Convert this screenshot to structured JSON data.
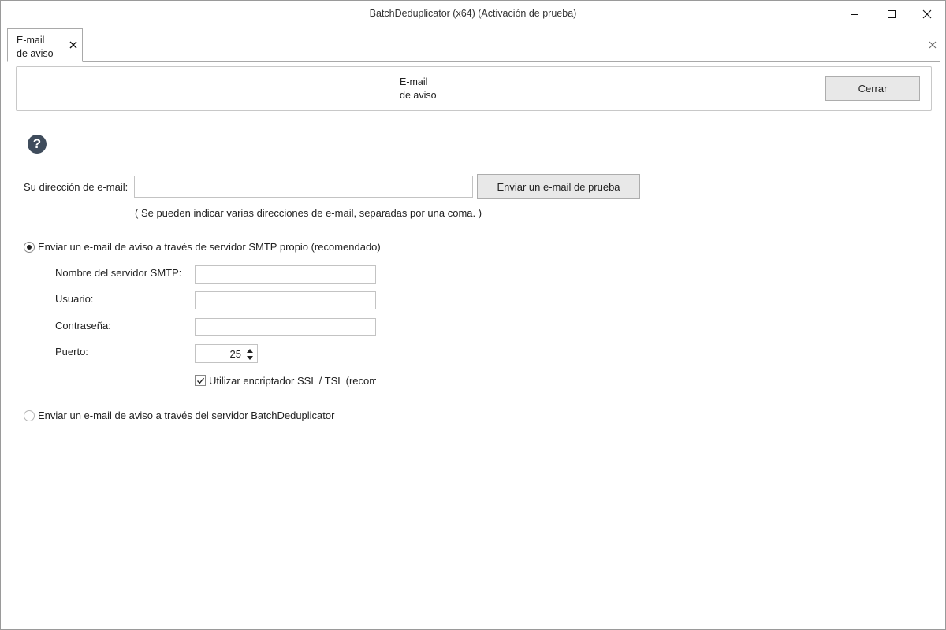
{
  "window": {
    "title": "BatchDeduplicator  (x64) (Activación de prueba)"
  },
  "tab": {
    "label": "E-mail\nde aviso"
  },
  "header": {
    "title": "E-mail\nde aviso",
    "close_label": "Cerrar"
  },
  "email": {
    "label": "Su dirección de e-mail:",
    "value": "",
    "test_button": "Enviar un e-mail de prueba",
    "hint": "( Se pueden indicar varias direcciones de e-mail, separadas por una coma. )"
  },
  "smtp_option": {
    "label": "Enviar un e-mail de aviso a través de servidor SMTP propio (recomendado)",
    "selected": true,
    "server_label": "Nombre del servidor SMTP:",
    "server_value": "",
    "user_label": "Usuario:",
    "user_value": "",
    "password_label": "Contraseña:",
    "password_value": "",
    "port_label": "Puerto:",
    "port_value": "25",
    "ssl_label": "Utilizar encriptador SSL / TSL (recomendado)",
    "ssl_checked": true
  },
  "server_option": {
    "label": "Enviar un e-mail de aviso a través del servidor BatchDeduplicator",
    "selected": false
  }
}
